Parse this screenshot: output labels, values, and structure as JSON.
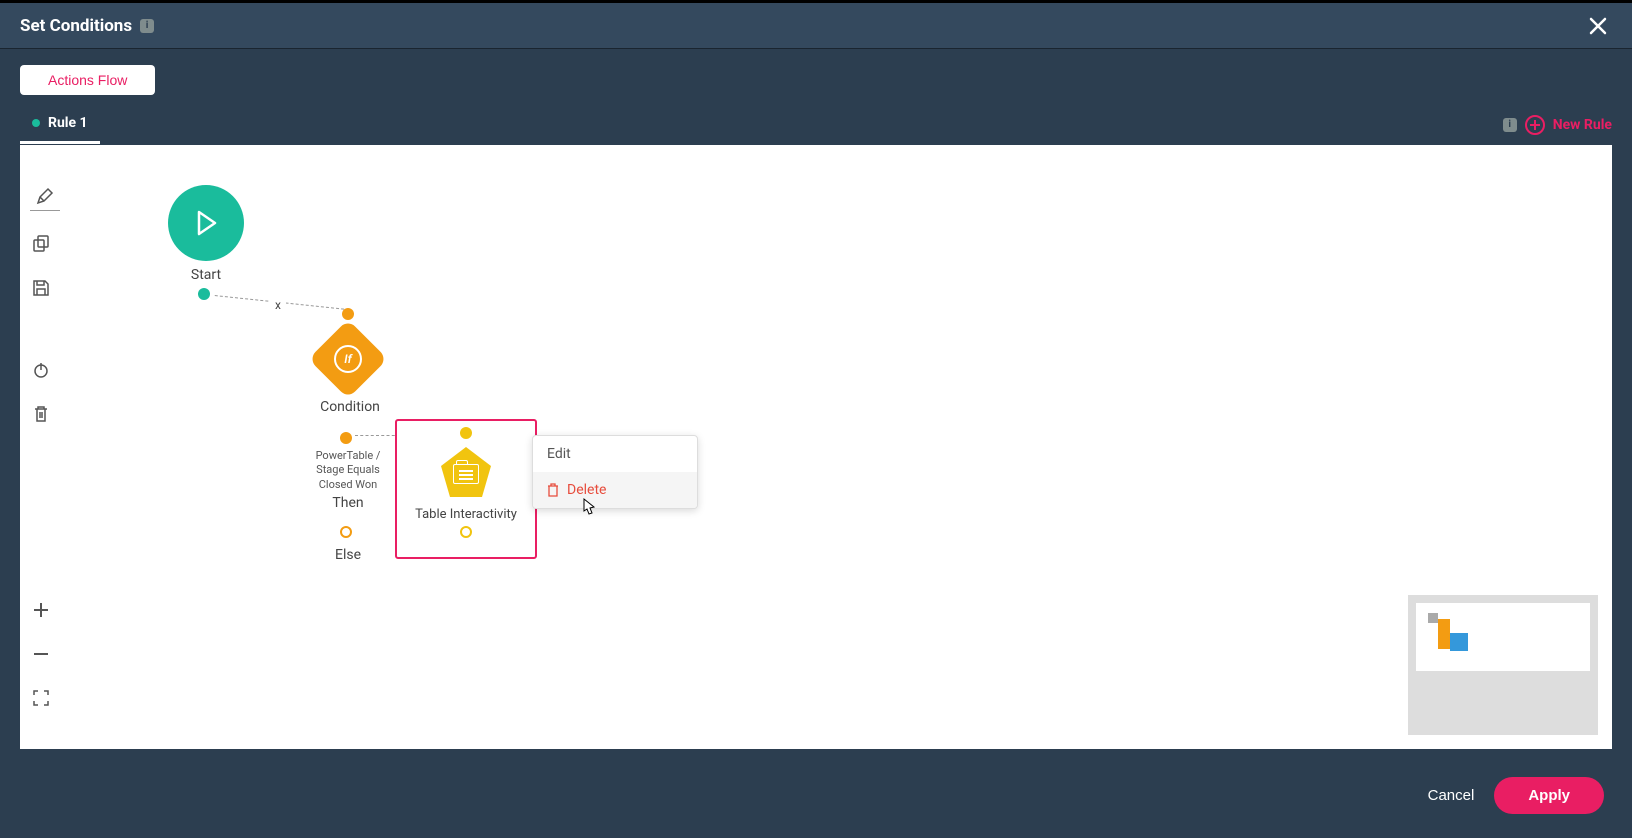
{
  "header": {
    "title": "Set Conditions"
  },
  "toolbar": {
    "actions_flow": "Actions Flow"
  },
  "tabs": {
    "active": "Rule 1",
    "new_rule": "New Rule"
  },
  "flow": {
    "start_label": "Start",
    "condition_label": "Condition",
    "condition_symbol": "If",
    "condition_text_line1": "PowerTable /",
    "condition_text_line2": "Stage Equals",
    "condition_text_line3": "Closed Won",
    "then_label": "Then",
    "else_label": "Else",
    "table_node_label": "Table Interactivity",
    "connector_x": "x"
  },
  "context_menu": {
    "edit": "Edit",
    "delete": "Delete"
  },
  "footer": {
    "cancel": "Cancel",
    "apply": "Apply"
  }
}
